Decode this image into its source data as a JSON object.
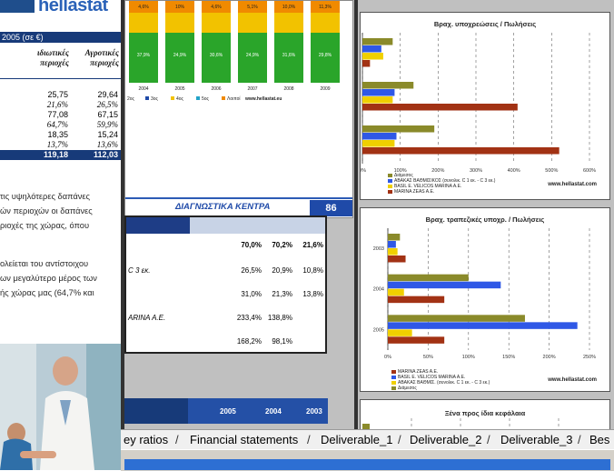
{
  "left_doc": {
    "logo_text": "hellastat",
    "table_header": "2005 (σε €)",
    "col_headers": [
      "ιδιωτικές περιοχές",
      "Αγροτικές περιοχές"
    ],
    "rows": [
      [
        "25,75",
        "29,64"
      ],
      [
        "21,6%",
        "26,5%"
      ],
      [
        "77,08",
        "67,15"
      ],
      [
        "64,7%",
        "59,9%"
      ],
      [
        "18,35",
        "15,24"
      ],
      [
        "13,7%",
        "13,6%"
      ],
      [
        "119,18",
        "112,03"
      ]
    ],
    "paragraphs": [
      "τις υψηλότερες δαπάνες",
      "ών περιοχών οι δαπάνες",
      "ριοχές της χώρας, όπου",
      "",
      "ολείεται του αντίστοιχου",
      "ων μεγαλύτερο μέρος των",
      "ής χώρας μας (64,7% και"
    ]
  },
  "page86": {
    "section_title": "ΔΙΑΓΝΩΣΤΙΚΑ ΚΕΝΤΡΑ",
    "page_number": "86",
    "bar_years": [
      "2004",
      "2005",
      "2006",
      "2007",
      "2008",
      "2009"
    ],
    "bar_top_labels": [
      "4,6%",
      "10%",
      "4,6%",
      "5,1%",
      "10,0%",
      "11,3%"
    ],
    "bar_mid_labels": [
      "37,9%",
      "24,9%",
      "30,6%",
      "24,9%",
      "31,6%",
      "29,8%"
    ],
    "legend": [
      "2oς",
      "3oς",
      "4oς",
      "5oς",
      "Λοιποί",
      "www.hellastat.eu"
    ]
  },
  "mid_table": {
    "rows": [
      {
        "label": "",
        "values": [
          "70,0%",
          "70,2%",
          "21,6%"
        ]
      },
      {
        "label": "C 3 εκ.",
        "values": [
          "26,5%",
          "20,9%",
          "10,8%"
        ]
      },
      {
        "label": "",
        "values": [
          "31,0%",
          "21,3%",
          "13,8%"
        ]
      },
      {
        "label": "ARINA A.E.",
        "values": [
          "233,4%",
          "138,8%",
          ""
        ]
      },
      {
        "label": "",
        "values": [
          "168,2%",
          "98,1%",
          ""
        ]
      }
    ],
    "bottom_years": [
      "2005",
      "2004",
      "2003"
    ]
  },
  "sheet_tabs": [
    "ey ratios",
    "Financial statements",
    "Deliverable_1",
    "Deliverable_2",
    "Deliverable_3",
    "Bes"
  ],
  "charts": [
    {
      "title": "Βραχ. υποχρεώσεις / Πωλήσεις",
      "x_ticks": [
        "0%",
        "100%",
        "200%",
        "300%",
        "400%",
        "500%",
        "600%"
      ],
      "legend": [
        "Διάμεσος",
        "ΑΒΑΚΑΣ ΒΑΘΜΙΣΙΚΟΣ (συνολικ. C 1 εκ. - C 3 εκ.)",
        "BASIL E. VELICOS MARINA A.E.",
        "MARINA ZEAS A.E."
      ],
      "url": "www.hellastat.com"
    },
    {
      "title": "Βραχ. τραπεζικές υποχρ. / Πωλήσεις",
      "y_labels": [
        "2003",
        "2004",
        "2005"
      ],
      "x_ticks": [
        "0%",
        "50%",
        "100%",
        "150%",
        "200%",
        "250%"
      ],
      "legend": [
        "MARINA ZEAS A.E.",
        "BASIL E. VELICOS MARINA A.E.",
        "ΑΒΑΚΑΣ ΒΑΘΜΙΣ. (συνολικ. C 1 εκ. - C 3 εκ.)",
        "Διάμεσος"
      ],
      "url": "www.hellastat.com"
    },
    {
      "title": "Ξένα προς ίδια κεφάλαια"
    }
  ],
  "chart_data": [
    {
      "type": "bar",
      "title": "Βραχ. υποχρεώσεις / Πωλήσεις",
      "orientation": "horizontal",
      "xlim": [
        0,
        600
      ],
      "series": [
        {
          "name": "Διάμεσος",
          "values": [
            80,
            135,
            190
          ]
        },
        {
          "name": "ΑΒΑΚΑΣ ΒΑΘΜΙΣΙΚΟΣ (συνολικ. C 1 εκ. - C 3 εκ.)",
          "values": [
            50,
            85,
            90
          ]
        },
        {
          "name": "BASIL E. VELICOS MARINA A.E.",
          "values": [
            55,
            80,
            85
          ]
        },
        {
          "name": "MARINA ZEAS A.E.",
          "values": [
            20,
            410,
            520
          ]
        }
      ]
    },
    {
      "type": "bar",
      "title": "Βραχ. τραπεζικές υποχρ. / Πωλήσεις",
      "orientation": "horizontal",
      "categories": [
        "2003",
        "2004",
        "2005"
      ],
      "xlim": [
        0,
        250
      ],
      "series": [
        {
          "name": "Διάμεσος",
          "values": [
            15,
            100,
            170
          ]
        },
        {
          "name": "ΑΒΑΚΑΣ ΒΑΘΜΙΣ. (συνολικ. C 1 εκ. - C 3 εκ.)",
          "values": [
            10,
            140,
            235
          ]
        },
        {
          "name": "BASIL E. VELICOS MARINA A.E.",
          "values": [
            12,
            20,
            30
          ]
        },
        {
          "name": "MARINA ZEAS A.E.",
          "values": [
            22,
            70,
            70
          ]
        }
      ]
    }
  ]
}
